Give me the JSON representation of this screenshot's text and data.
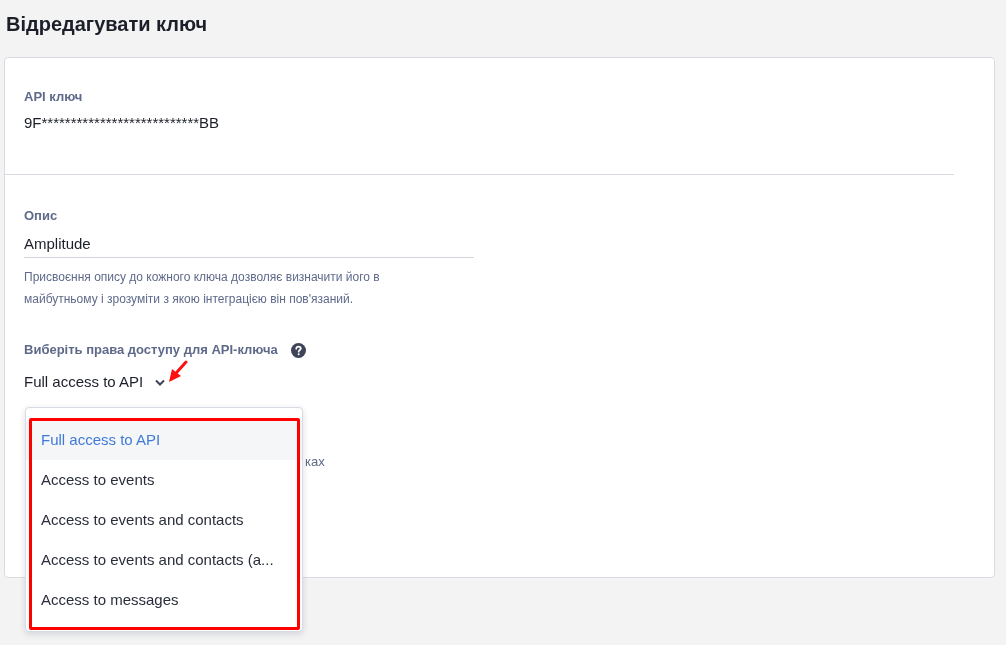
{
  "page": {
    "title": "Відредагувати ключ"
  },
  "api_key": {
    "label": "API ключ",
    "value": "9F***************************BB"
  },
  "description": {
    "label": "Опис",
    "value": "Amplitude",
    "hint": "Присвоєння опису до кожного ключа дозволяє визначити його в майбутньому і зрозуміти з якою інтеграцією він пов'язаний."
  },
  "permissions": {
    "label": "Виберіть права доступу для API-ключа",
    "value": "Full access to API",
    "expanded": true,
    "options": [
      {
        "label": "Full access to API",
        "selected": true
      },
      {
        "label": "Access to events",
        "selected": false
      },
      {
        "label": "Access to events and contacts",
        "selected": false
      },
      {
        "label": "Access to events and contacts (a...",
        "selected": false
      },
      {
        "label": "Access to messages",
        "selected": false
      }
    ],
    "covered_text": "ках"
  }
}
